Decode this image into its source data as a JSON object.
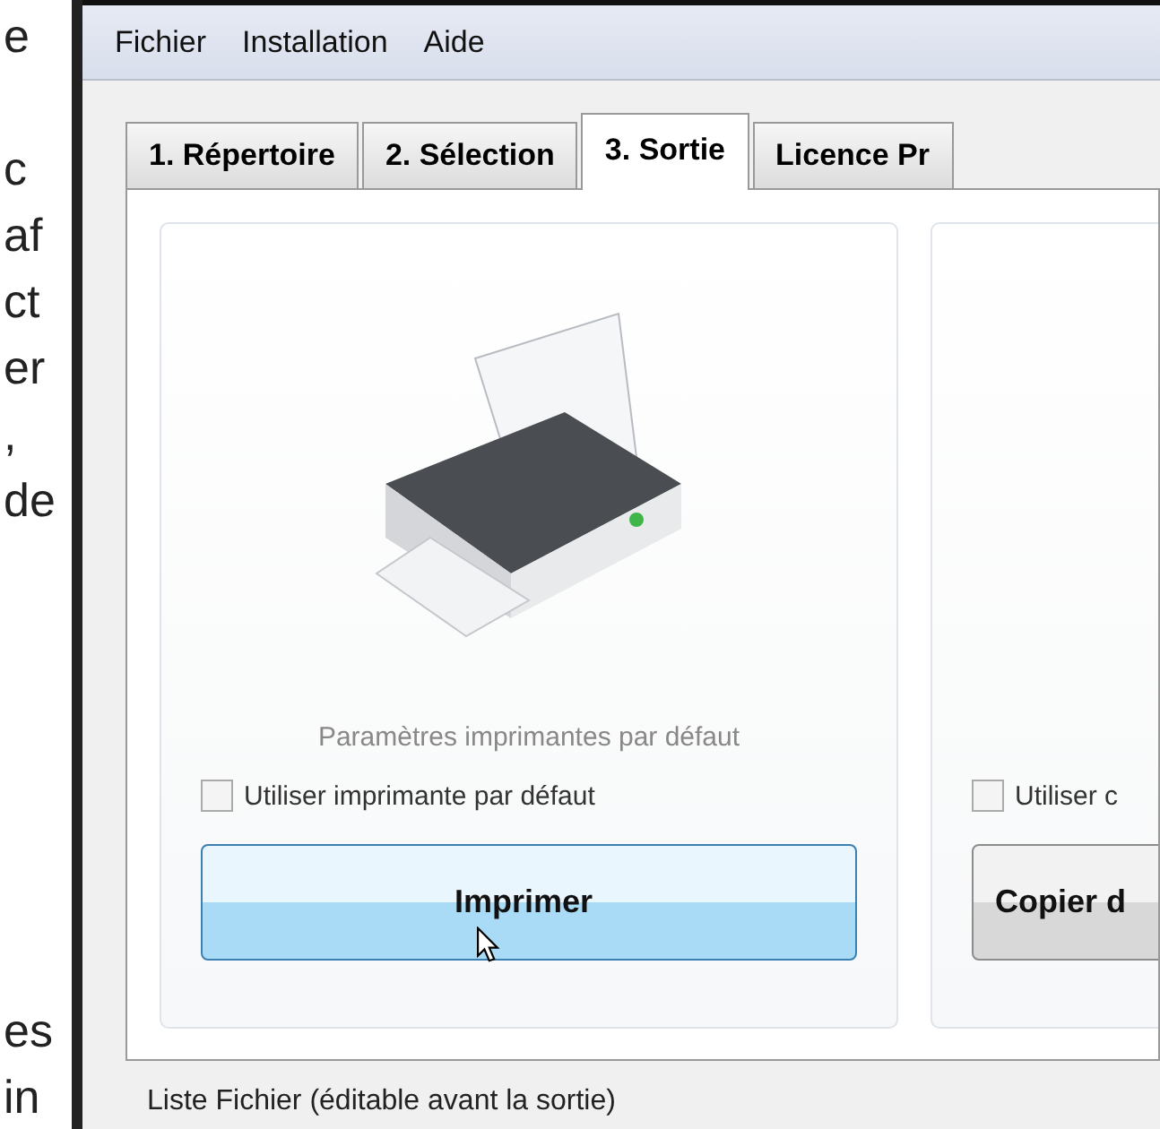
{
  "background_text": [
    "e",
    "c",
    "af",
    "ct",
    "er",
    ",",
    "de",
    "es",
    "in"
  ],
  "menu": [
    {
      "label": "Fichier"
    },
    {
      "label": "Installation"
    },
    {
      "label": "Aide"
    }
  ],
  "tabs": [
    {
      "label": "1. Répertoire",
      "selected": false
    },
    {
      "label": "2. Sélection",
      "selected": false
    },
    {
      "label": "3. Sortie",
      "selected": true
    },
    {
      "label": "Licence Pr",
      "selected": false
    }
  ],
  "cards": [
    {
      "caption": "Paramètres imprimantes par défaut",
      "checkbox": {
        "label": "Utiliser imprimante par défaut",
        "checked": false
      },
      "button": {
        "label": "Imprimer",
        "hovered": true
      }
    },
    {
      "checkbox": {
        "label": "Utiliser c",
        "checked": false
      },
      "button": {
        "label": "Copier d",
        "hovered": false
      }
    }
  ],
  "list_label": "Liste Fichier (éditable avant la sortie)"
}
